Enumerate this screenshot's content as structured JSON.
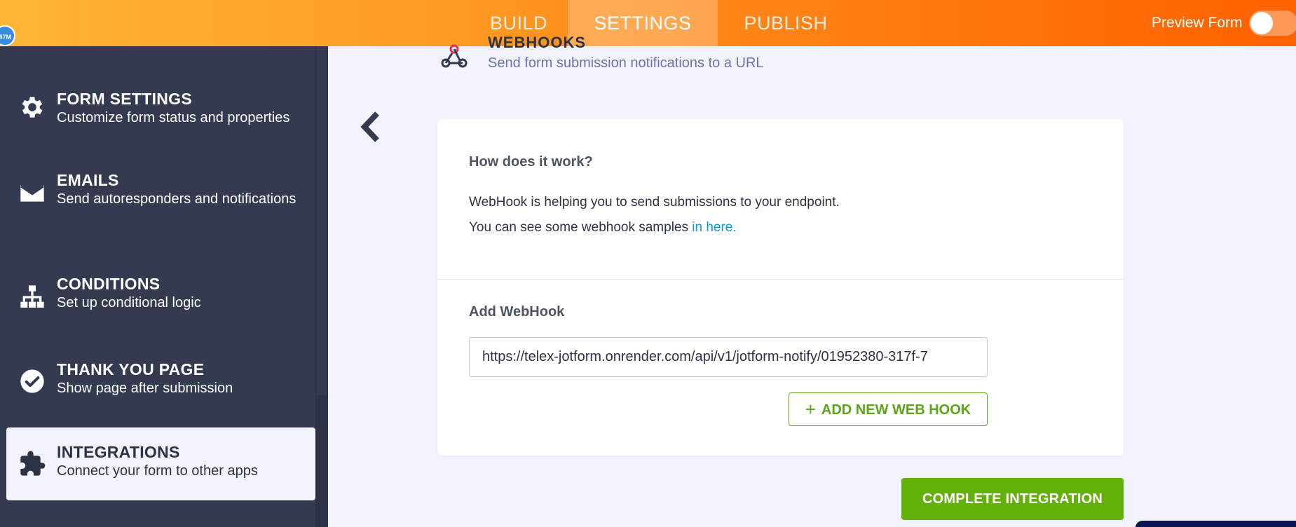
{
  "topbar": {
    "tabs": [
      {
        "label": "BUILD"
      },
      {
        "label": "SETTINGS"
      },
      {
        "label": "PUBLISH"
      }
    ],
    "avatar_text": "87M",
    "preview_label": "Preview Form",
    "preview_on": false
  },
  "sidebar": {
    "items": [
      {
        "title": "FORM SETTINGS",
        "desc": "Customize form status and properties",
        "icon": "gear-icon"
      },
      {
        "title": "EMAILS",
        "desc": "Send autoresponders and notifications",
        "icon": "envelope-icon"
      },
      {
        "title": "CONDITIONS",
        "desc": "Set up conditional logic",
        "icon": "sitemap-icon"
      },
      {
        "title": "THANK YOU PAGE",
        "desc": "Show page after submission",
        "icon": "check-circle-icon"
      },
      {
        "title": "INTEGRATIONS",
        "desc": "Connect your form to other apps",
        "icon": "puzzle-icon"
      }
    ]
  },
  "main": {
    "header_title": "WEBHOOKS",
    "header_sub": "Send form submission notifications to a URL",
    "how_title": "How does it work?",
    "line1": "WebHook is helping you to send submissions to your endpoint.",
    "line2_prefix": "You can see some webhook samples ",
    "line2_link": "in here.",
    "add_label": "Add WebHook",
    "url_value": "https://telex-jotform.onrender.com/api/v1/jotform-notify/01952380-317f-7",
    "add_button": "ADD NEW WEB HOOK",
    "complete_button": "COMPLETE INTEGRATION"
  },
  "colors": {
    "accent_orange": "#ff7a10",
    "sidebar_bg": "#343a4f",
    "green": "#64b00a",
    "link": "#0a9bdf"
  }
}
